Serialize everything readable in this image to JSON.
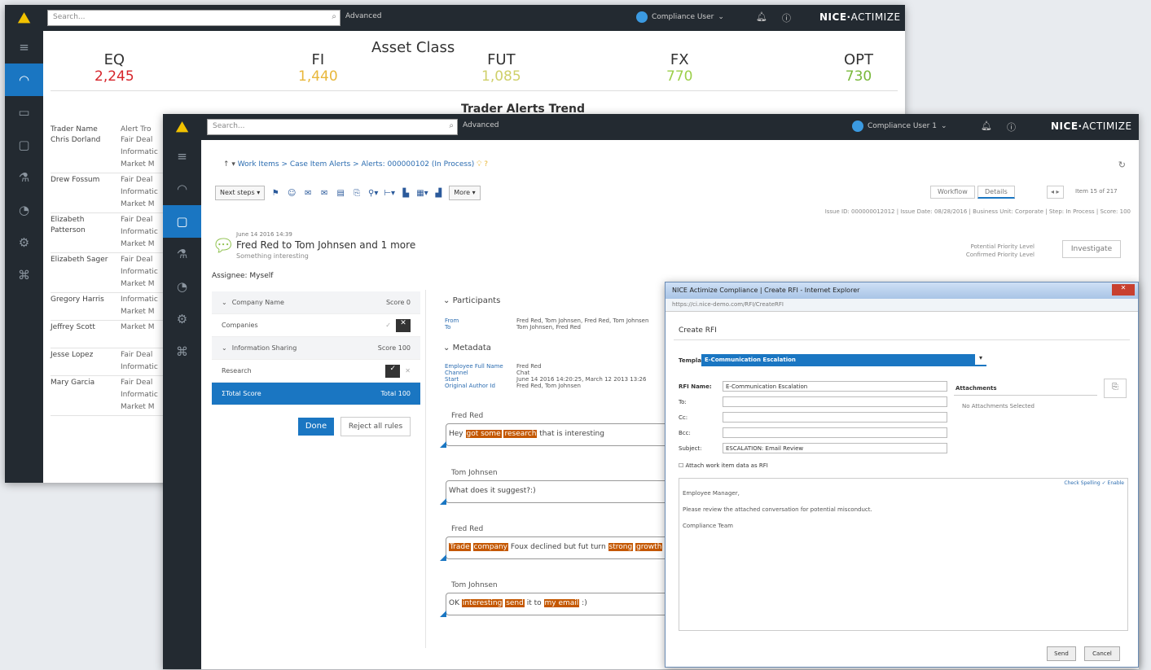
{
  "app": {
    "search_placeholder": "Search...",
    "advanced": "Advanced",
    "brand_bold": "NICE",
    "brand_light": "ACTIMIZE"
  },
  "window1": {
    "user": "Compliance User",
    "asset_title": "Asset Class",
    "asset_classes": [
      {
        "label": "EQ",
        "value": "2,245",
        "color": "#d6252b"
      },
      {
        "label": "FI",
        "value": "1,440",
        "color": "#e8b73a"
      },
      {
        "label": "FUT",
        "value": "1,085",
        "color": "#cfd06a"
      },
      {
        "label": "FX",
        "value": "770",
        "color": "#9ccf4a"
      },
      {
        "label": "OPT",
        "value": "730",
        "color": "#79b83b"
      }
    ],
    "trend_title": "Trader Alerts Trend",
    "col_trader": "Trader Name",
    "col_alert": "Alert Tro",
    "traders": [
      {
        "name": "Chris Dorland",
        "alerts": [
          "Fair Deal",
          "Informatic",
          "Market M"
        ]
      },
      {
        "name": "Drew Fossum",
        "alerts": [
          "Fair Deal",
          "Informatic",
          "Market M"
        ]
      },
      {
        "name": "Elizabeth Patterson",
        "alerts": [
          "Fair Deal",
          "Informatic",
          "Market M"
        ]
      },
      {
        "name": "Elizabeth Sager",
        "alerts": [
          "Fair Deal",
          "Informatic",
          "Market M"
        ]
      },
      {
        "name": "Gregory Harris",
        "alerts": [
          "Informatic",
          "Market M"
        ]
      },
      {
        "name": "Jeffrey Scott",
        "alerts": [
          "Market M"
        ]
      },
      {
        "name": "Jesse Lopez",
        "alerts": [
          "Fair Deal",
          "Informatic"
        ]
      },
      {
        "name": "Mary Garcia",
        "alerts": [
          "Fair Deal",
          "Informatic",
          "Market M"
        ]
      }
    ]
  },
  "window2": {
    "user": "Compliance User 1",
    "breadcrumb": "Work Items > Case Item Alerts > Alerts: 000000102 (In Process)",
    "next_steps": "Next steps",
    "more": "More",
    "seg_workflow": "Workflow",
    "seg_details": "Details",
    "item_count": "Item 15 of 217",
    "meta_line": "Issue ID: 000000012012 | Issue Date: 08/28/2016 | Business Unit: Corporate | Step: In Process | Score: 100",
    "email_date": "June 14 2016 14:39",
    "email_subject": "Fred Red to Tom Johnsen and 1 more",
    "email_sub2": "Something interesting",
    "assignee": "Assignee: Myself",
    "potential_priority": "Potential Priority Level",
    "confirmed_priority": "Confirmed Priority Level",
    "investigate": "Investigate",
    "rules": [
      {
        "label": "Company Name",
        "right": "Score 0",
        "type": "grey"
      },
      {
        "label": "Companies",
        "right": "",
        "type": "plain"
      },
      {
        "label": "Information Sharing",
        "right": "Score 100",
        "type": "grey"
      },
      {
        "label": "Research",
        "right": "",
        "type": "plain"
      },
      {
        "label": "Total Score",
        "right": "Total 100",
        "type": "total"
      }
    ],
    "done": "Done",
    "reject": "Reject all rules",
    "participants": "Participants",
    "from_k": "From",
    "from_v": "Fred Red, Tom Johnsen, Fred Red, Tom Johnsen",
    "to_k": "To",
    "to_v": "Tom Johnsen, Fred Red",
    "metadata": "Metadata",
    "emp_k": "Employee Full Name",
    "emp_v": "Fred Red",
    "channel_k": "Channel",
    "channel_v": "Chat",
    "start_k": "Start",
    "start_v": "June 14 2016 14:20:25, March 12 2013 13:26",
    "orig_k": "Original Author Id",
    "orig_v": "Fred Red, Tom Johnsen",
    "chats": [
      {
        "name": "Fred Red",
        "parts": [
          {
            "t": "Hey ",
            "h": false
          },
          {
            "t": "got some",
            "h": true
          },
          {
            "t": " ",
            "h": false
          },
          {
            "t": "research",
            "h": true
          },
          {
            "t": " that is interesting",
            "h": false
          }
        ]
      },
      {
        "name": "Tom Johnsen",
        "parts": [
          {
            "t": "What does it suggest?:)",
            "h": false
          }
        ]
      },
      {
        "name": "Fred Red",
        "parts": [
          {
            "t": "Trade",
            "h": true
          },
          {
            "t": " ",
            "h": false
          },
          {
            "t": "company",
            "h": true
          },
          {
            "t": " Foux declined but fut turn ",
            "h": false
          },
          {
            "t": "strong",
            "h": true
          },
          {
            "t": " ",
            "h": false
          },
          {
            "t": "growth",
            "h": true
          }
        ]
      },
      {
        "name": "Tom Johnsen",
        "parts": [
          {
            "t": "OK ",
            "h": false
          },
          {
            "t": "interesting",
            "h": true
          },
          {
            "t": " ",
            "h": false
          },
          {
            "t": "send",
            "h": true
          },
          {
            "t": " it ",
            "h": false
          },
          {
            "t": "to",
            "h": false
          },
          {
            "t": " ",
            "h": false
          },
          {
            "t": "my email",
            "h": true
          },
          {
            "t": " :)",
            "h": false
          }
        ]
      }
    ]
  },
  "dialog": {
    "title": "NICE Actimize Compliance | Create RFI - Internet Explorer",
    "url": "https://ci.nice-demo.com/RFI/CreateRFI",
    "heading": "Create RFI",
    "template_label": "Template:",
    "template_value": "E-Communication Escalation",
    "rfi_name_label": "RFI Name:",
    "rfi_name_value": "E-Communication Escalation",
    "to_label": "To:",
    "cc_label": "Cc:",
    "bcc_label": "Bcc:",
    "subject_label": "Subject:",
    "subject_value": "ESCALATION: Email Review",
    "attachments_label": "Attachments",
    "no_attachments": "No Attachments Selected",
    "attach_check": "Attach work item data as RFI",
    "body_links": "Check Spelling ✓ Enable",
    "body_lines": [
      "Employee Manager,",
      "Please review the attached conversation for potential misconduct.",
      "Compliance Team"
    ],
    "send": "Send",
    "cancel": "Cancel"
  }
}
